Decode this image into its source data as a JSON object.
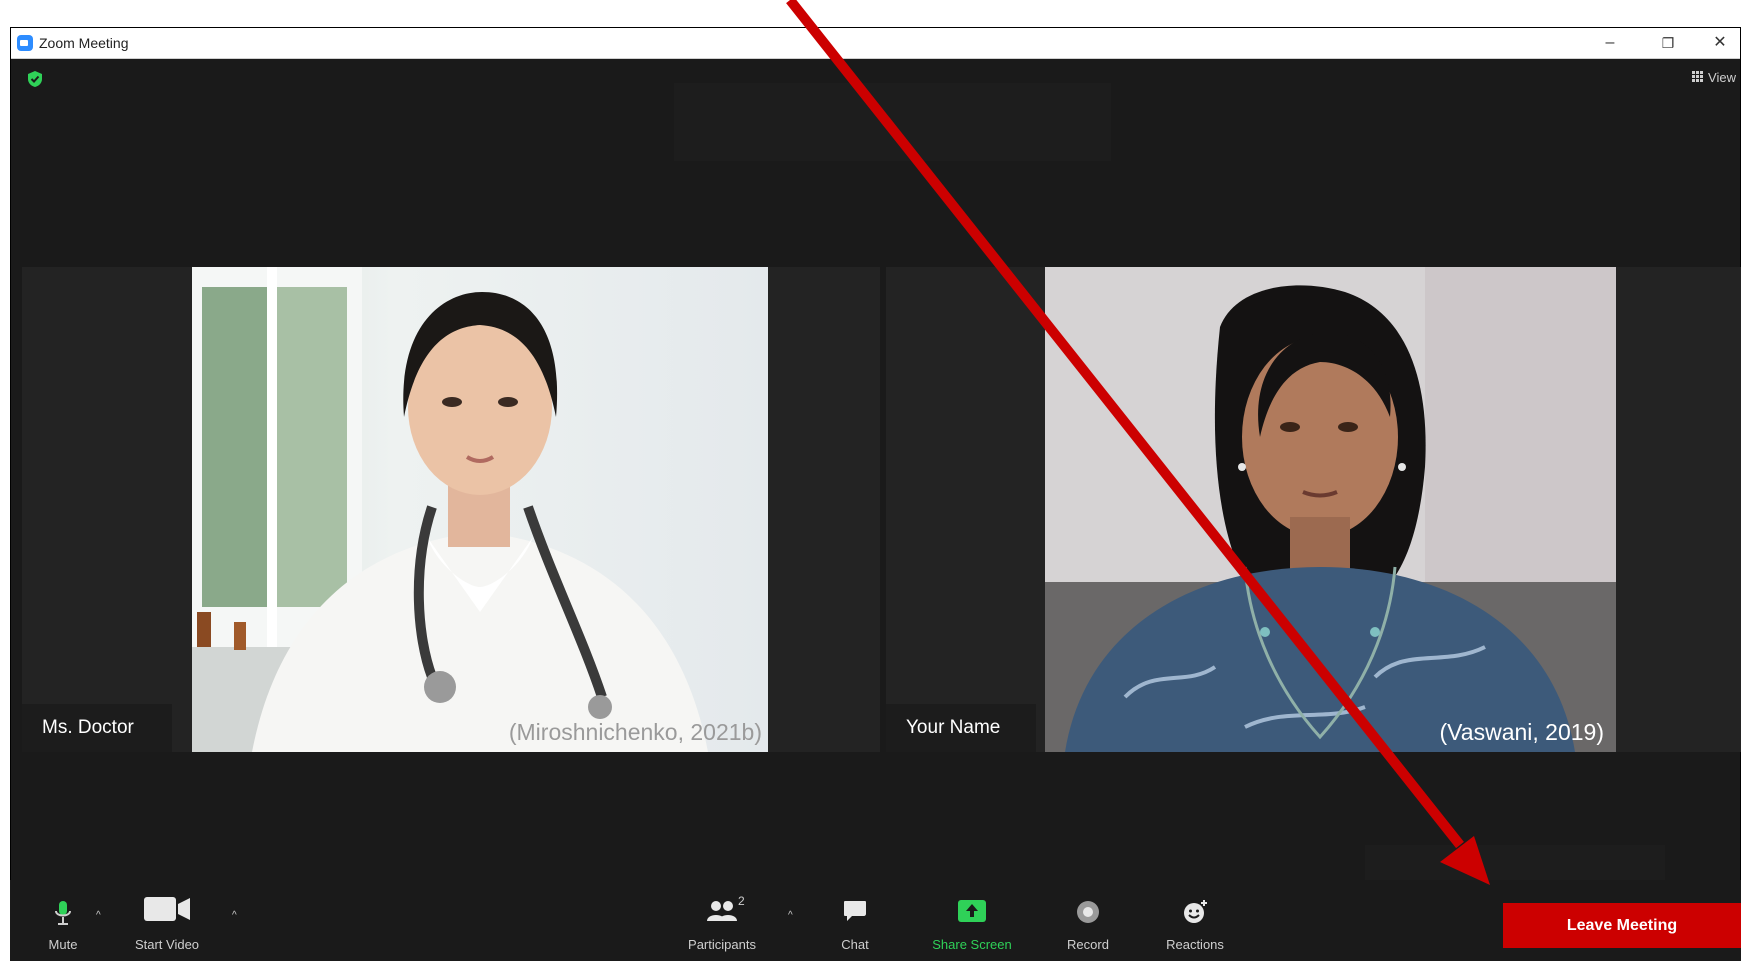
{
  "window": {
    "title": "Zoom Meeting",
    "minimize": "–",
    "restore": "❐",
    "close": "✕"
  },
  "header": {
    "view_label": "View"
  },
  "tiles": [
    {
      "name": "Ms.  Doctor",
      "credit": "(Miroshnichenko, 2021b)"
    },
    {
      "name": "Your  Name",
      "credit": "(Vaswani, 2019)"
    }
  ],
  "toolbar": {
    "mute_label": "Mute",
    "start_video_label": "Start Video",
    "participants_label": "Participants",
    "participants_count": "2",
    "chat_label": "Chat",
    "share_screen_label": "Share Screen",
    "record_label": "Record",
    "reactions_label": "Reactions",
    "leave_label": "Leave Meeting"
  },
  "colors": {
    "accent_green": "#2fd158",
    "leave_red": "#cc0000",
    "arrow_red": "#cc0000",
    "background": "#1a1a1a"
  }
}
